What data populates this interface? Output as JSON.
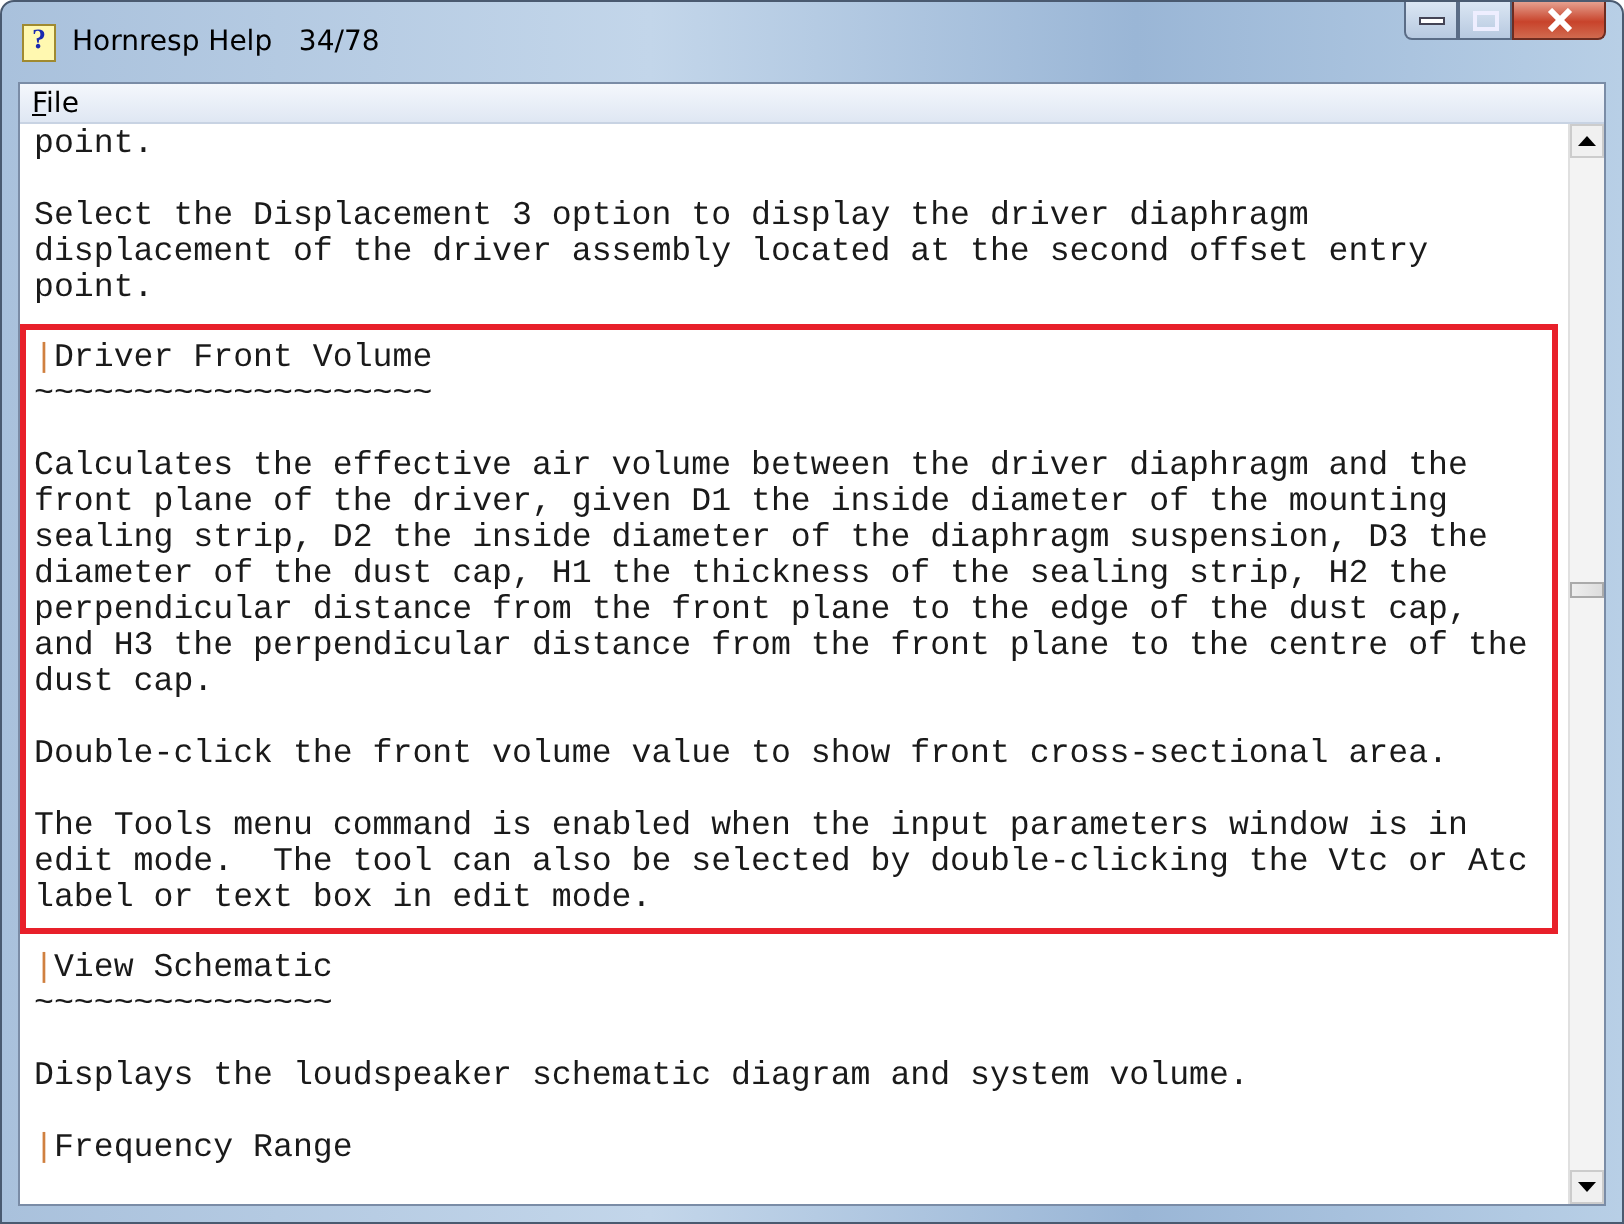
{
  "window": {
    "icon": "?",
    "title": "Hornresp Help   34/78"
  },
  "menu": [
    {
      "label": "File"
    }
  ],
  "sections": [
    {
      "highlighted": false,
      "blocks": [
        {
          "kind": "paragraph",
          "lines": [
            "point."
          ]
        },
        {
          "kind": "paragraph",
          "lines": [
            "Select the Displacement 3 option to display the driver diaphragm",
            "displacement of the driver assembly located at the second offset entry",
            "point."
          ]
        }
      ]
    },
    {
      "highlighted": true,
      "blocks": [
        {
          "kind": "heading",
          "lines": [
            "|Driver Front Volume"
          ]
        },
        {
          "kind": "rule",
          "lines": [
            "~~~~~~~~~~~~~~~~~~~~"
          ]
        },
        {
          "kind": "paragraph",
          "lines": [
            "Calculates the effective air volume between the driver diaphragm and the",
            "front plane of the driver, given D1 the inside diameter of the mounting",
            "sealing strip, D2 the inside diameter of the diaphragm suspension, D3 the",
            "diameter of the dust cap, H1 the thickness of the sealing strip, H2 the",
            "perpendicular distance from the front plane to the edge of the dust cap,",
            "and H3 the perpendicular distance from the front plane to the centre of the",
            "dust cap."
          ]
        },
        {
          "kind": "paragraph",
          "lines": [
            "Double-click the front volume value to show front cross-sectional area."
          ]
        },
        {
          "kind": "paragraph",
          "lines": [
            "The Tools menu command is enabled when the input parameters window is in",
            "edit mode.  The tool can also be selected by double-clicking the Vtc or Atc",
            "label or text box in edit mode."
          ]
        }
      ]
    },
    {
      "highlighted": false,
      "blocks": [
        {
          "kind": "heading",
          "lines": [
            "|View Schematic"
          ]
        },
        {
          "kind": "rule",
          "lines": [
            "~~~~~~~~~~~~~~~"
          ]
        },
        {
          "kind": "paragraph",
          "lines": [
            "Displays the loudspeaker schematic diagram and system volume."
          ]
        },
        {
          "kind": "heading",
          "lines": [
            "|Frequency Range"
          ]
        }
      ]
    }
  ]
}
